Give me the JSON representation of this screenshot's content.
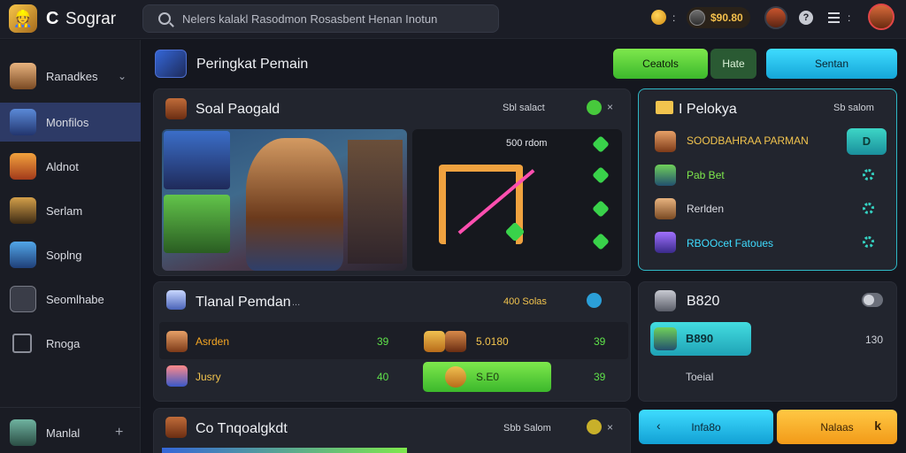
{
  "app": {
    "mark": "C",
    "title": "Sograr"
  },
  "search": {
    "placeholder": "Nelers kalakl Rasodmon Rosasbent Henan Inotun"
  },
  "header": {
    "coin_dots": ":",
    "wallet_amount": "$90.80",
    "menu_dots": ":",
    "help": "?"
  },
  "sidebar": {
    "items": [
      {
        "label": "Ranadkes",
        "chevron": "⌄"
      },
      {
        "label": "Monfilos"
      },
      {
        "label": "Aldnot"
      },
      {
        "label": "Serlam"
      },
      {
        "label": "Soplng"
      },
      {
        "label": "Seomlhabe"
      },
      {
        "label": "Rnoga"
      }
    ],
    "footer": {
      "label": "Manlal",
      "plus": "+"
    }
  },
  "page": {
    "title": "Peringkat Pemain"
  },
  "actions": {
    "green": "Ceatols",
    "dark": "Hate",
    "cyan": "Sentan"
  },
  "panel_main": {
    "title": "Soal Paogald",
    "meta": "Sbl salact",
    "close": "×"
  },
  "tile": {
    "label": "500 rdom"
  },
  "panel_list": {
    "title": "Tlanal Pemdan",
    "ellipsis": "...",
    "meta": "400 Solas",
    "rows": [
      {
        "name": "Asrden",
        "value": "39"
      },
      {
        "name": "Jusry",
        "value": "40"
      }
    ],
    "rows_right": [
      {
        "name": "5.0180",
        "value": "39"
      },
      {
        "name": "S.E0",
        "value": "39"
      }
    ]
  },
  "panel_bottom": {
    "title": "Co Tnqoalgkdt",
    "meta": "Sbb Salom",
    "close": "×"
  },
  "panel_right": {
    "title": "I Pelokya",
    "meta": "Sb salom",
    "items": [
      {
        "label": "SOODBAHRAA PARMAN",
        "btn": "D"
      },
      {
        "label": "Pab Bet"
      },
      {
        "label": "Rerlden"
      },
      {
        "label": "RBOOcet Fatoues"
      }
    ]
  },
  "panel_score": {
    "value": "B820",
    "pill_value": "B890",
    "side_value": "130",
    "sub_label": "Toeial"
  },
  "bottom_buttons": {
    "left_arrow": "‹",
    "cyan": "Infa8o",
    "orange": "Nalaas",
    "orange_icon": "k"
  },
  "colors": {
    "accent_green": "#5fe24a",
    "accent_cyan": "#2cc4e8",
    "accent_orange": "#f5a623",
    "active_nav": "#2d3a66"
  }
}
